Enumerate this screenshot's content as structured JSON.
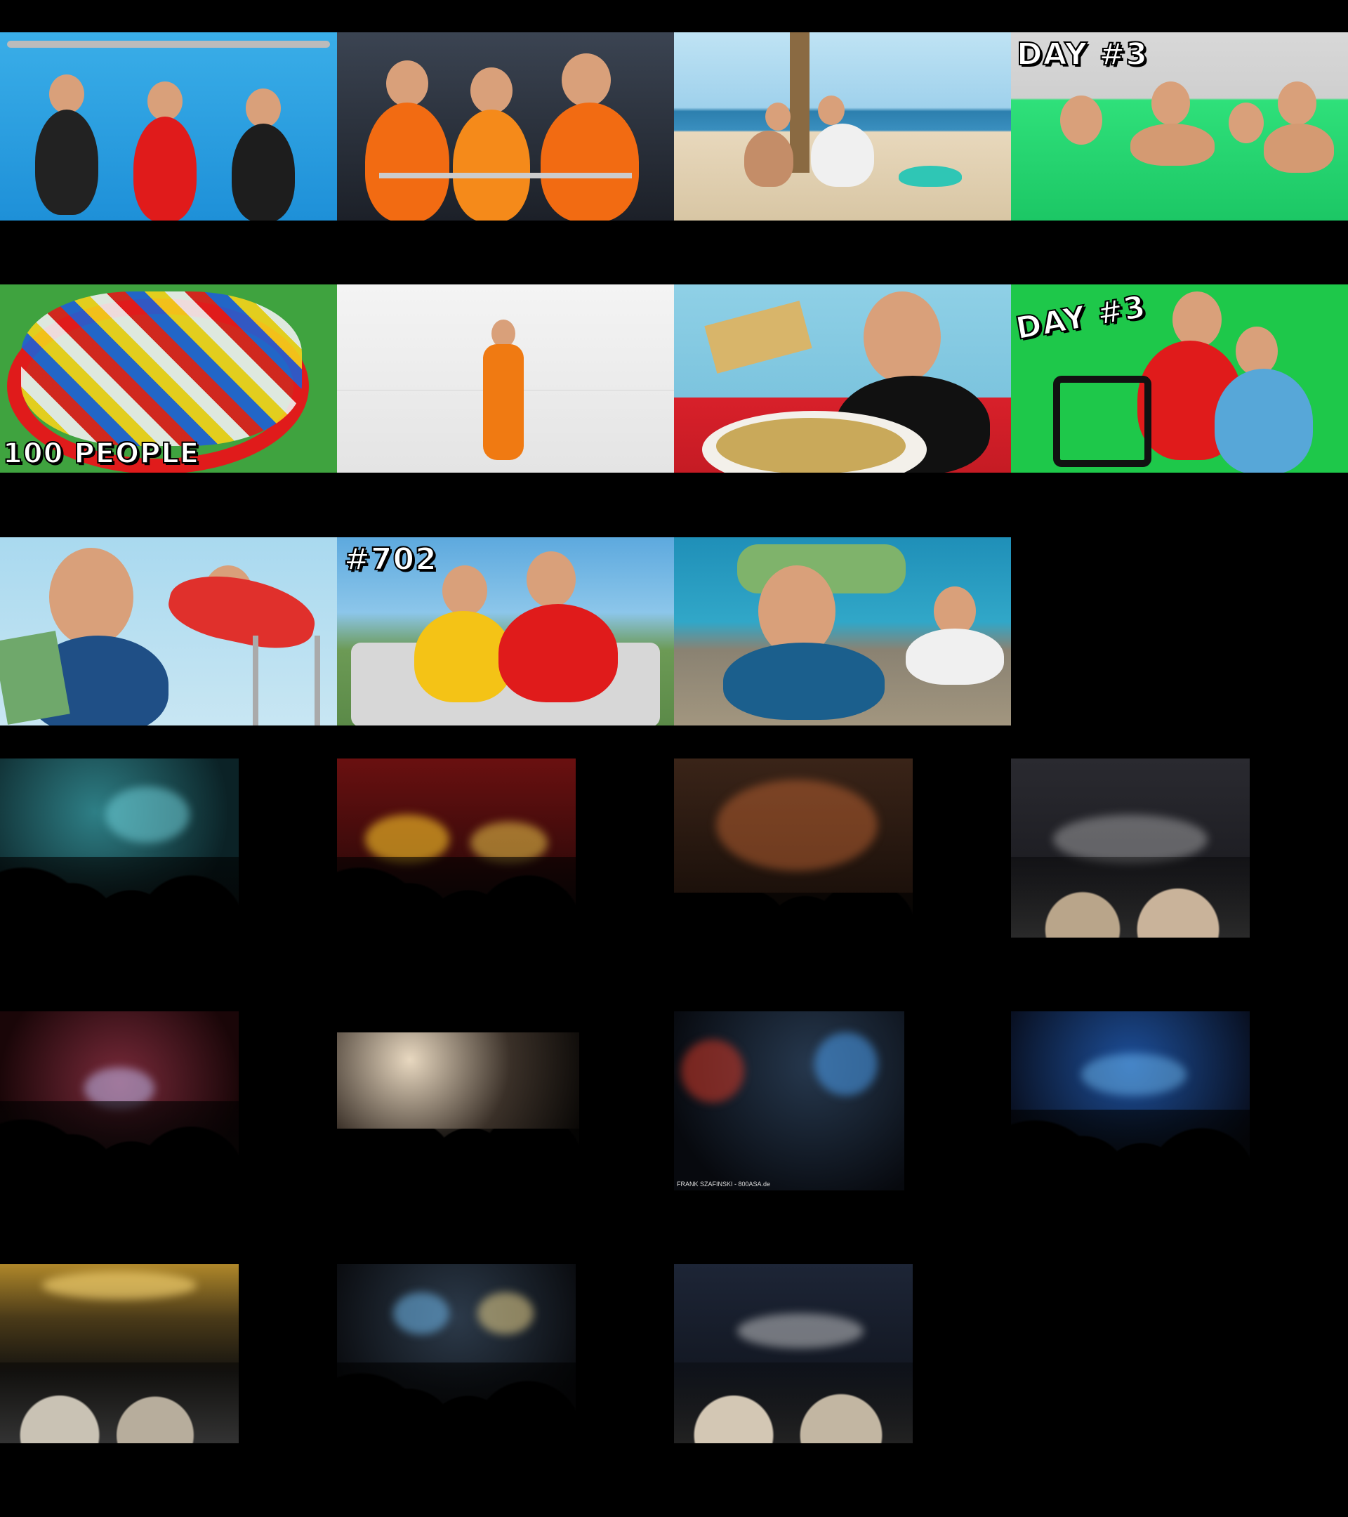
{
  "gallery_videos": {
    "thumbnails": [
      {
        "name": "thumb-hanging-bar",
        "caption": ""
      },
      {
        "name": "thumb-life-jackets",
        "caption": ""
      },
      {
        "name": "thumb-beach-palm",
        "caption": ""
      },
      {
        "name": "thumb-slime-pool",
        "caption": "DAY #3"
      },
      {
        "name": "thumb-100-people-circle",
        "caption": "100 PEOPLE"
      },
      {
        "name": "thumb-white-room",
        "caption": ""
      },
      {
        "name": "thumb-gold-pizza",
        "caption": ""
      },
      {
        "name": "thumb-exercise-bike",
        "caption": "DAY #3"
      },
      {
        "name": "thumb-money-skydive",
        "caption": ""
      },
      {
        "name": "thumb-ferris-wheel",
        "caption": "#702"
      },
      {
        "name": "thumb-island-cliff",
        "caption": ""
      }
    ]
  },
  "gallery_concerts": {
    "watermark": "FRANK SZAFINSKI - 800ASA.de"
  },
  "colors": {
    "background": "#000000",
    "accent_red": "#e01b1b",
    "pool_blue": "#2aa7e6",
    "slime_green": "#26d96e"
  }
}
